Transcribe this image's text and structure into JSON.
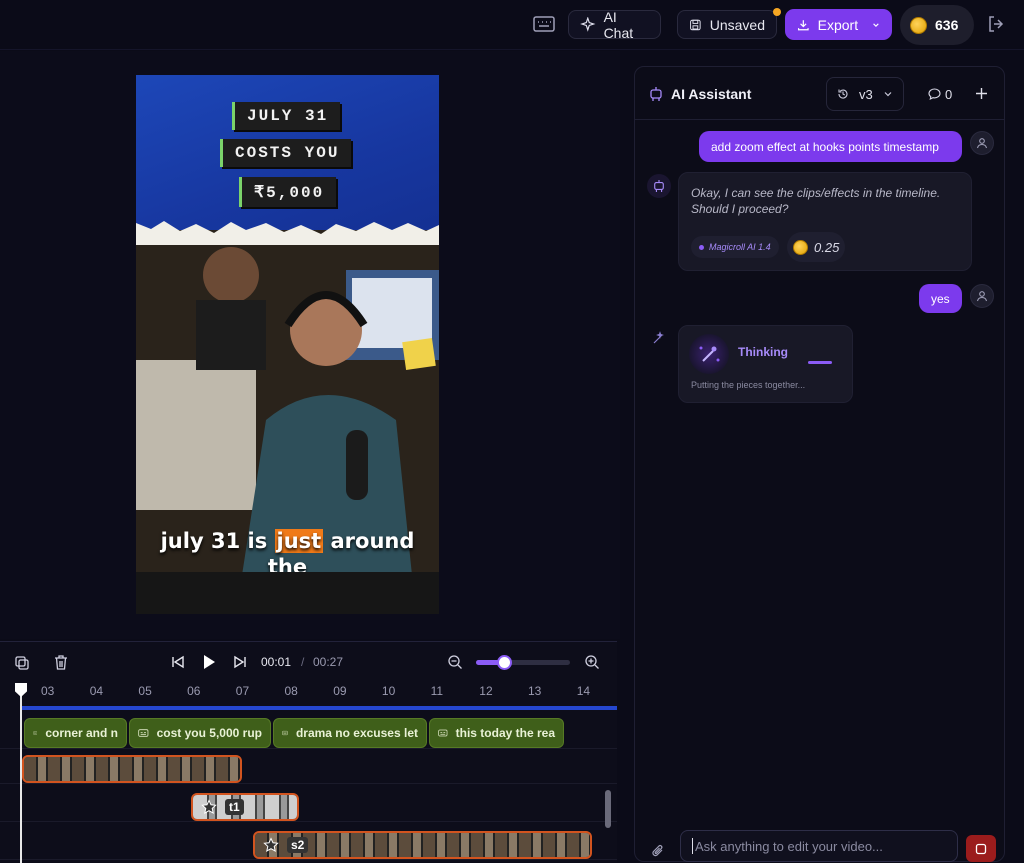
{
  "topbar": {
    "ai_chat_label": "AI Chat",
    "unsaved_label": "Unsaved",
    "export_label": "Export",
    "coin_balance": "636"
  },
  "video": {
    "headline": [
      "JULY 31",
      "COSTS YOU",
      "₹5,000"
    ],
    "caption_pre": "july 31 is ",
    "caption_highlight": "just",
    "caption_post": " around",
    "caption_line2": "the",
    "caption_highlight_color": "#f07a18"
  },
  "timeline": {
    "current_time": "00:01",
    "separator": "/",
    "total_time": "00:27",
    "zoom_level": 0.3,
    "ruler_ticks": [
      "03",
      "04",
      "05",
      "06",
      "07",
      "08",
      "09",
      "10",
      "11",
      "12",
      "13",
      "14"
    ],
    "caption_clips": [
      "corner and n",
      "cost you 5,000 rup",
      "drama no excuses let",
      "this today the rea"
    ],
    "transition_label": "t1",
    "scene_label": "s2"
  },
  "assistant": {
    "title": "AI Assistant",
    "version": "v3",
    "comment_count": "0",
    "messages": [
      {
        "role": "user",
        "text": "add zoom effect at hooks points timestamp"
      },
      {
        "role": "assistant",
        "text_line1": "Okay, I can see the clips/effects in the timeline.",
        "text_line2": "Should I proceed?",
        "model": "Magicroll AI 1.4",
        "cost": "0.25"
      },
      {
        "role": "user",
        "text": "yes"
      },
      {
        "role": "assistant",
        "status": "Thinking",
        "status_detail": "Putting the pieces together..."
      }
    ],
    "input_placeholder": "Ask anything to edit your video..."
  },
  "colors": {
    "accent": "#7c3aed",
    "caption_clip": "#3f5f1a",
    "video_clip_border": "#d2541f"
  }
}
